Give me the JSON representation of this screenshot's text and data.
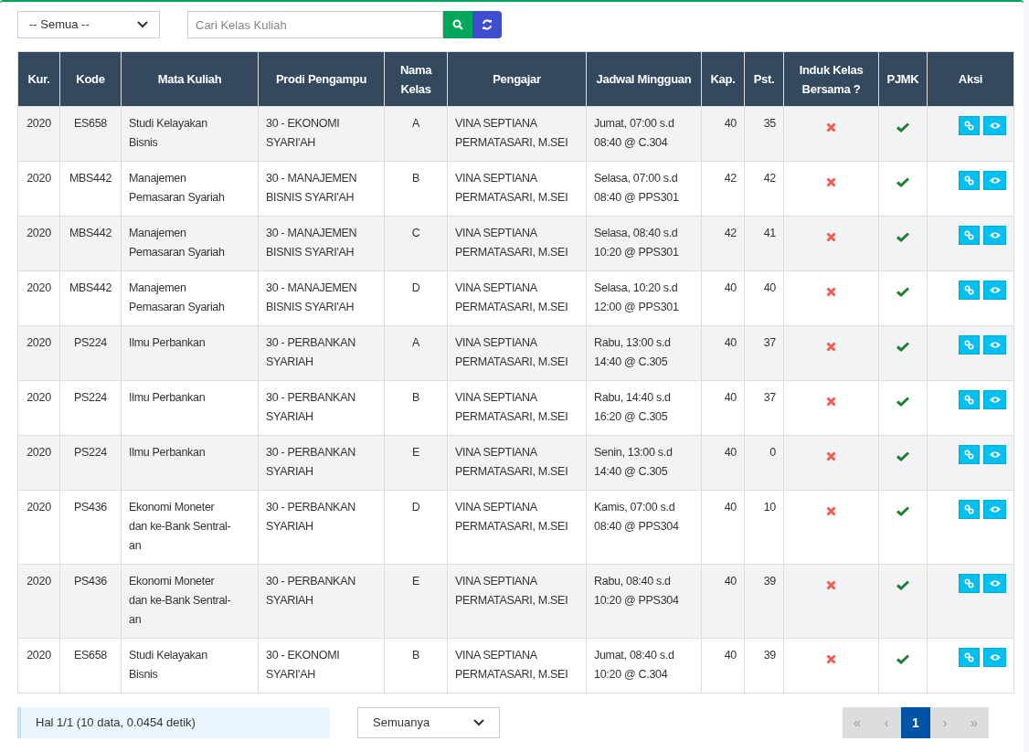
{
  "filter": {
    "value": "-- Semua --"
  },
  "search": {
    "placeholder": "Cari Kelas Kuliah"
  },
  "table": {
    "columns": [
      "Kur.",
      "Kode",
      "Mata Kuliah",
      "Prodi Pengampu",
      "Nama Kelas",
      "Pengajar",
      "Jadwal Mingguan",
      "Kap.",
      "Pst.",
      "Induk Kelas Bersama ?",
      "PJMK",
      "Aksi"
    ],
    "rows": [
      {
        "kur": "2020",
        "kode": "ES658",
        "mata_kuliah": "Studi Kelayakan\nBisnis",
        "prodi": "30 - EKONOMI\nSYARI'AH",
        "kelas": "A",
        "pengajar": "VINA SEPTIANA\nPERMATASARI, M.SEI",
        "jadwal": "Jumat, 07:00 s.d\n08:40 @ C.304",
        "kap": "40",
        "pst": "35",
        "induk": false,
        "pjmk": true
      },
      {
        "kur": "2020",
        "kode": "MBS442",
        "mata_kuliah": "Manajemen\nPemasaran Syariah",
        "prodi": "30 - MANAJEMEN\nBISNIS SYARI'AH",
        "kelas": "B",
        "pengajar": "VINA SEPTIANA\nPERMATASARI, M.SEI",
        "jadwal": "Selasa, 07:00 s.d\n08:40 @ PPS301",
        "kap": "42",
        "pst": "42",
        "induk": false,
        "pjmk": true
      },
      {
        "kur": "2020",
        "kode": "MBS442",
        "mata_kuliah": "Manajemen\nPemasaran Syariah",
        "prodi": "30 - MANAJEMEN\nBISNIS SYARI'AH",
        "kelas": "C",
        "pengajar": "VINA SEPTIANA\nPERMATASARI, M.SEI",
        "jadwal": "Selasa, 08:40 s.d\n10:20 @ PPS301",
        "kap": "42",
        "pst": "41",
        "induk": false,
        "pjmk": true
      },
      {
        "kur": "2020",
        "kode": "MBS442",
        "mata_kuliah": "Manajemen\nPemasaran Syariah",
        "prodi": "30 - MANAJEMEN\nBISNIS SYARI'AH",
        "kelas": "D",
        "pengajar": "VINA SEPTIANA\nPERMATASARI, M.SEI",
        "jadwal": "Selasa, 10:20 s.d\n12:00 @ PPS301",
        "kap": "40",
        "pst": "40",
        "induk": false,
        "pjmk": true
      },
      {
        "kur": "2020",
        "kode": "PS224",
        "mata_kuliah": "Ilmu Perbankan",
        "prodi": "30 - PERBANKAN\nSYARIAH",
        "kelas": "A",
        "pengajar": "VINA SEPTIANA\nPERMATASARI, M.SEI",
        "jadwal": "Rabu, 13:00 s.d\n14:40 @ C.305",
        "kap": "40",
        "pst": "37",
        "induk": false,
        "pjmk": true
      },
      {
        "kur": "2020",
        "kode": "PS224",
        "mata_kuliah": "Ilmu Perbankan",
        "prodi": "30 - PERBANKAN\nSYARIAH",
        "kelas": "B",
        "pengajar": "VINA SEPTIANA\nPERMATASARI, M.SEI",
        "jadwal": "Rabu, 14:40 s.d\n16:20 @ C.305",
        "kap": "40",
        "pst": "37",
        "induk": false,
        "pjmk": true
      },
      {
        "kur": "2020",
        "kode": "PS224",
        "mata_kuliah": "Ilmu Perbankan",
        "prodi": "30 - PERBANKAN\nSYARIAH",
        "kelas": "E",
        "pengajar": "VINA SEPTIANA\nPERMATASARI, M.SEI",
        "jadwal": "Senin, 13:00 s.d\n14:40 @ C.305",
        "kap": "40",
        "pst": "0",
        "induk": false,
        "pjmk": true
      },
      {
        "kur": "2020",
        "kode": "PS436",
        "mata_kuliah": "Ekonomi Moneter\ndan ke-Bank Sentral-\nan",
        "prodi": "30 - PERBANKAN\nSYARIAH",
        "kelas": "D",
        "pengajar": "VINA SEPTIANA\nPERMATASARI, M.SEI",
        "jadwal": "Kamis, 07:00 s.d\n08:40 @ PPS304",
        "kap": "40",
        "pst": "10",
        "induk": false,
        "pjmk": true
      },
      {
        "kur": "2020",
        "kode": "PS436",
        "mata_kuliah": "Ekonomi Moneter\ndan ke-Bank Sentral-\nan",
        "prodi": "30 - PERBANKAN\nSYARIAH",
        "kelas": "E",
        "pengajar": "VINA SEPTIANA\nPERMATASARI, M.SEI",
        "jadwal": "Rabu, 08:40 s.d\n10:20 @ PPS304",
        "kap": "40",
        "pst": "39",
        "induk": false,
        "pjmk": true
      },
      {
        "kur": "2020",
        "kode": "ES658",
        "mata_kuliah": "Studi Kelayakan\nBisnis",
        "prodi": "30 - EKONOMI\nSYARI'AH",
        "kelas": "B",
        "pengajar": "VINA SEPTIANA\nPERMATASARI, M.SEI",
        "jadwal": "Jumat, 08:40 s.d\n10:20 @ C.304",
        "kap": "40",
        "pst": "39",
        "induk": false,
        "pjmk": true
      }
    ]
  },
  "footer": {
    "info": "Hal 1/1 (10 data, 0.0454 detik)",
    "page_size": "Semuanya"
  },
  "pagination": [
    {
      "label": "«",
      "selected": false,
      "disabled": true
    },
    {
      "label": "‹",
      "selected": false,
      "disabled": true
    },
    {
      "label": "1",
      "selected": true,
      "disabled": false
    },
    {
      "label": "›",
      "selected": false,
      "disabled": true
    },
    {
      "label": "»",
      "selected": false,
      "disabled": true
    }
  ]
}
